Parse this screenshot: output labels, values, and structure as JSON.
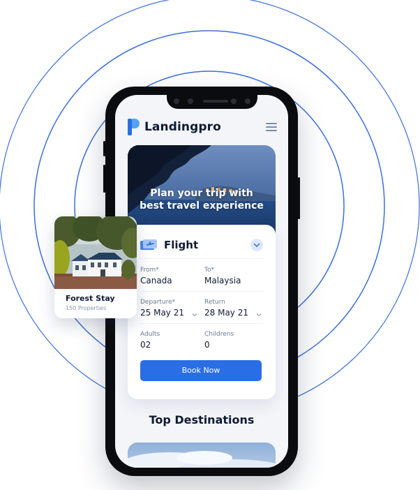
{
  "header": {
    "brand": "Landingpro",
    "logo_icon": "landingpro-logo-icon",
    "menu_icon": "hamburger-menu-icon"
  },
  "hero": {
    "title_line1": "Plan your trip with",
    "title_line2": "best travel experience"
  },
  "flight_card": {
    "title": "Flight",
    "icon": "flight-ticket-icon",
    "toggle_icon": "chevron-down-icon",
    "from": {
      "label": "From*",
      "value": "Canada"
    },
    "to": {
      "label": "To*",
      "value": "Malaysia"
    },
    "departure": {
      "label": "Departure*",
      "value": "25 May 21"
    },
    "return": {
      "label": "Return",
      "value": "28 May 21"
    },
    "adults": {
      "label": "Adults",
      "value": "02"
    },
    "childrens": {
      "label": "Childrens",
      "value": "0"
    },
    "book_button": "Book Now"
  },
  "destinations": {
    "title": "Top Destinations"
  },
  "property_card": {
    "title": "Forest Stay",
    "subtitle": "150 Properties"
  },
  "colors": {
    "accent": "#2a6ee5",
    "ring": "#3a6fdc",
    "text": "#0f1b33",
    "phone": "#0b0c0f"
  }
}
